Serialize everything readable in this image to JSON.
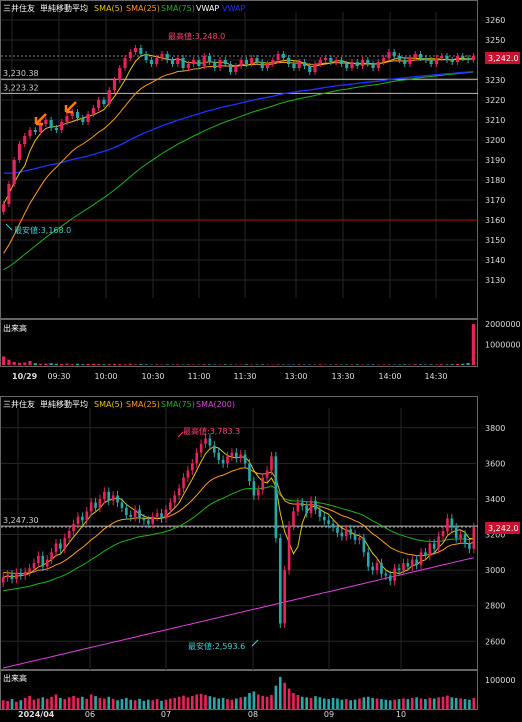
{
  "chart_data": [
    {
      "type": "candlestick",
      "name": "intraday",
      "symbol": "三井住友",
      "indicator_label": "単純移動平均",
      "legend": [
        {
          "name": "SMA(5)",
          "color": "#e8c400"
        },
        {
          "name": "SMA(25)",
          "color": "#ff9a1a"
        },
        {
          "name": "SMA(75)",
          "color": "#1bb51b"
        },
        {
          "name": "VWAP",
          "color": "#ffffff"
        },
        {
          "name": "VWAP",
          "color": "#2030ff"
        }
      ],
      "ylim": [
        3122,
        3263
      ],
      "yticks": [
        3130,
        3140,
        3150,
        3160,
        3170,
        3180,
        3190,
        3200,
        3210,
        3220,
        3230,
        3240,
        3250,
        3260
      ],
      "xticks": [
        "10/29",
        "09:30",
        "10:00",
        "10:30",
        "11:00",
        "11:30",
        "13:00",
        "13:30",
        "14:00",
        "14:30"
      ],
      "high_label": "最高値:3,248.0",
      "low_label": "最安値:3,168.0",
      "high_value": 3248.0,
      "low_value": 3168.0,
      "last_label": "3,242.0",
      "last_value": 3242.0,
      "hlines": [
        {
          "label": "3,230.38",
          "value": 3230.38,
          "color": "#bbbbbb"
        },
        {
          "label": "3,223.32",
          "value": 3223.32,
          "color": "#bbbbbb"
        },
        {
          "label": "",
          "value": 3160,
          "color": "#c01010"
        }
      ],
      "close": [
        3168,
        3178,
        3190,
        3198,
        3202,
        3205,
        3204,
        3208,
        3210,
        3206,
        3205,
        3209,
        3212,
        3214,
        3211,
        3209,
        3213,
        3216,
        3220,
        3218,
        3225,
        3230,
        3236,
        3241,
        3244,
        3246,
        3243,
        3240,
        3238,
        3241,
        3243,
        3240,
        3238,
        3241,
        3236,
        3238,
        3240,
        3237,
        3242,
        3239,
        3236,
        3240,
        3238,
        3234,
        3237,
        3240,
        3238,
        3241,
        3239,
        3236,
        3238,
        3240,
        3243,
        3241,
        3238,
        3236,
        3239,
        3237,
        3234,
        3238,
        3240,
        3241,
        3239,
        3240,
        3238,
        3236,
        3239,
        3237,
        3240,
        3238,
        3236,
        3239,
        3241,
        3244,
        3242,
        3240,
        3238,
        3241,
        3243,
        3241,
        3240,
        3238,
        3241,
        3242,
        3240,
        3239,
        3242,
        3241,
        3240,
        3242
      ],
      "sma25_start": 3140,
      "sma75_start": 3134,
      "vwap_start": 3184,
      "volume": {
        "label": "出来高",
        "yticks": [
          1000000,
          2000000
        ],
        "ytick_labels": [
          "1000000",
          "2000000"
        ],
        "ylim": [
          0,
          2100000
        ],
        "values": [
          420000,
          260000,
          150000,
          110000,
          120000,
          200000,
          90000,
          60000,
          70000,
          90000,
          60000,
          50000,
          70000,
          40000,
          60000,
          40000,
          50000,
          60000,
          50000,
          30000,
          40000,
          50000,
          40000,
          30000,
          60000,
          30000,
          40000,
          30000,
          20000,
          30000,
          20000,
          30000,
          20000,
          30000,
          20000,
          30000,
          20000,
          20000,
          40000,
          30000,
          20000,
          20000,
          30000,
          20000,
          20000,
          20000,
          30000,
          20000,
          20000,
          30000,
          20000,
          20000,
          30000,
          20000,
          20000,
          20000,
          30000,
          20000,
          20000,
          20000,
          30000,
          20000,
          20000,
          30000,
          20000,
          20000,
          20000,
          30000,
          20000,
          20000,
          30000,
          20000,
          20000,
          30000,
          20000,
          20000,
          30000,
          20000,
          40000,
          30000,
          20000,
          30000,
          30000,
          40000,
          30000,
          40000,
          50000,
          60000,
          100000,
          2000000
        ]
      }
    },
    {
      "type": "candlestick",
      "name": "daily",
      "symbol": "三井住友",
      "indicator_label": "単純移動平均",
      "legend": [
        {
          "name": "SMA(5)",
          "color": "#e8c400"
        },
        {
          "name": "SMA(25)",
          "color": "#ff9a1a"
        },
        {
          "name": "SMA(75)",
          "color": "#1bb51b"
        },
        {
          "name": "SMA(200)",
          "color": "#e040e0"
        }
      ],
      "ylim": [
        2450,
        3900
      ],
      "yticks": [
        2600,
        2800,
        3000,
        3200,
        3400,
        3600,
        3800
      ],
      "xticks": [
        "2024/04",
        "06",
        "07",
        "08",
        "09",
        "10"
      ],
      "high_label": "最高値:3,783.3",
      "low_label": "最安値:2,593.6",
      "high_value": 3783.3,
      "low_value": 2593.6,
      "last_label": "3,242.0",
      "last_value": 3242.0,
      "hlines": [
        {
          "label": "3,247.30",
          "value": 3247.3,
          "color": "#bbbbbb"
        }
      ],
      "close": [
        2960,
        2975,
        2950,
        2985,
        2970,
        2990,
        3010,
        3040,
        3080,
        3020,
        3060,
        3100,
        3150,
        3120,
        3180,
        3220,
        3260,
        3300,
        3280,
        3330,
        3380,
        3350,
        3400,
        3440,
        3390,
        3420,
        3380,
        3350,
        3310,
        3300,
        3340,
        3290,
        3280,
        3260,
        3300,
        3320,
        3290,
        3340,
        3380,
        3420,
        3460,
        3520,
        3560,
        3600,
        3660,
        3710,
        3740,
        3700,
        3660,
        3620,
        3600,
        3640,
        3660,
        3630,
        3650,
        3600,
        3500,
        3420,
        3450,
        3520,
        3560,
        3640,
        3180,
        2700,
        3000,
        3250,
        3330,
        3380,
        3360,
        3320,
        3390,
        3340,
        3300,
        3280,
        3260,
        3240,
        3210,
        3190,
        3230,
        3200,
        3170,
        3180,
        3100,
        3020,
        3000,
        3040,
        2980,
        2970,
        2940,
        3010,
        3000,
        3040,
        3020,
        3060,
        3030,
        3100,
        3080,
        3150,
        3120,
        3190,
        3220,
        3290,
        3240,
        3180,
        3200,
        3150,
        3120,
        3242
      ],
      "sma25_start": 2990,
      "sma75_start": 2880,
      "sma200_start": 2450,
      "sma200_end": 3070,
      "volume": {
        "label": "出来高",
        "yticks": [
          100000
        ],
        "ytick_labels": [
          "100000"
        ],
        "ylim": [
          0,
          120000
        ],
        "values": [
          30000,
          28000,
          34000,
          25000,
          30000,
          38000,
          45000,
          32000,
          36000,
          40000,
          35000,
          42000,
          50000,
          38000,
          34000,
          40000,
          45000,
          38000,
          42000,
          35000,
          50000,
          44000,
          38000,
          36000,
          42000,
          35000,
          30000,
          34000,
          38000,
          32000,
          30000,
          35000,
          28000,
          32000,
          30000,
          34000,
          28000,
          32000,
          36000,
          38000,
          42000,
          46000,
          40000,
          45000,
          50000,
          52000,
          48000,
          44000,
          40000,
          36000,
          38000,
          34000,
          32000,
          36000,
          40000,
          42000,
          55000,
          60000,
          50000,
          45000,
          42000,
          48000,
          80000,
          110000,
          90000,
          70000,
          55000,
          48000,
          42000,
          40000,
          38000,
          44000,
          40000,
          36000,
          34000,
          38000,
          36000,
          32000,
          34000,
          30000,
          32000,
          36000,
          40000,
          42000,
          38000,
          36000,
          34000,
          32000,
          30000,
          32000,
          34000,
          36000,
          34000,
          38000,
          40000,
          36000,
          34000,
          38000,
          36000,
          40000,
          42000,
          46000,
          40000,
          38000,
          36000,
          34000,
          32000,
          38000
        ]
      }
    }
  ]
}
